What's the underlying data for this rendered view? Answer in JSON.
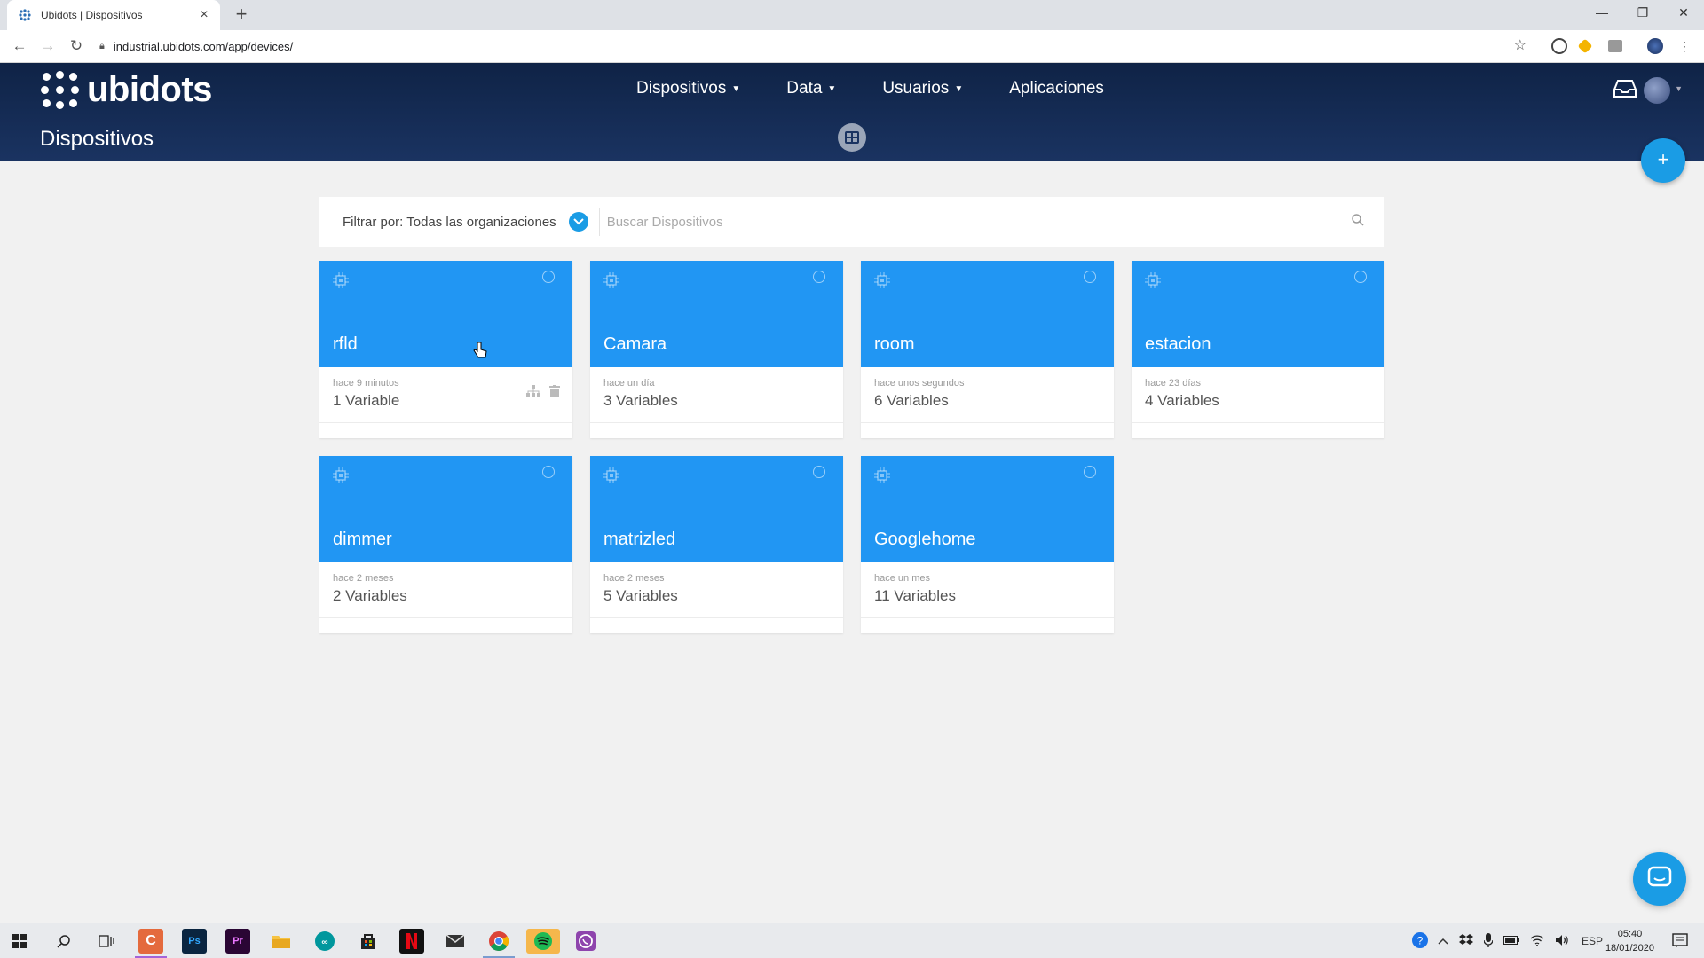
{
  "browser": {
    "tab_title": "Ubidots | Dispositivos",
    "url": "industrial.ubidots.com/app/devices/"
  },
  "brand": {
    "name": "ubidots",
    "header_color": "#13294f",
    "accent": "#2196f3"
  },
  "nav": {
    "items": [
      {
        "label": "Dispositivos",
        "has_caret": true
      },
      {
        "label": "Data",
        "has_caret": true
      },
      {
        "label": "Usuarios",
        "has_caret": true
      },
      {
        "label": "Aplicaciones",
        "has_caret": false
      }
    ]
  },
  "page": {
    "title": "Dispositivos",
    "add_button": "+"
  },
  "filter": {
    "label": "Filtrar por: Todas las organizaciones",
    "search_placeholder": "Buscar Dispositivos"
  },
  "devices": [
    {
      "name": "rfld",
      "last_activity": "hace 9 minutos",
      "variables": "1 Variable"
    },
    {
      "name": "Camara",
      "last_activity": "hace un día",
      "variables": "3 Variables"
    },
    {
      "name": "room",
      "last_activity": "hace unos segundos",
      "variables": "6 Variables"
    },
    {
      "name": "estacion",
      "last_activity": "hace 23 días",
      "variables": "4 Variables"
    },
    {
      "name": "dimmer",
      "last_activity": "hace 2 meses",
      "variables": "2 Variables"
    },
    {
      "name": "matrizled",
      "last_activity": "hace 2 meses",
      "variables": "5 Variables"
    },
    {
      "name": "Googlehome",
      "last_activity": "hace un mes",
      "variables": "11 Variables"
    }
  ],
  "taskbar": {
    "language": "ESP",
    "time": "05:40",
    "date": "18/01/2020",
    "apps": [
      "windows-start",
      "search",
      "task-view",
      "c-app",
      "photoshop",
      "premiere",
      "file-explorer",
      "arduino",
      "store",
      "netflix",
      "mail",
      "chrome",
      "spotify",
      "whatsapp"
    ],
    "ps_label": "Ps",
    "pr_label": "Pr"
  }
}
